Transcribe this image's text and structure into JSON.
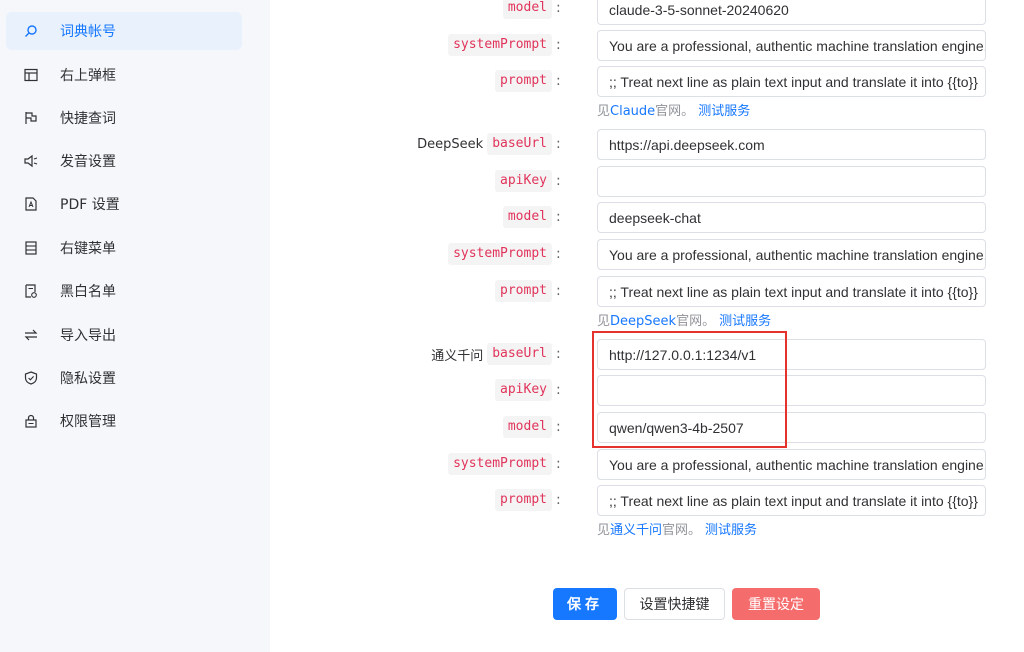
{
  "sidebar": {
    "items": [
      {
        "label": "词典帐号",
        "icon": "search-icon",
        "active": true
      },
      {
        "label": "右上弹框",
        "icon": "panel-icon"
      },
      {
        "label": "快捷查词",
        "icon": "flag-icon"
      },
      {
        "label": "发音设置",
        "icon": "speaker-icon"
      },
      {
        "label": "PDF 设置",
        "icon": "pdf-icon"
      },
      {
        "label": "右键菜单",
        "icon": "menu-list-icon"
      },
      {
        "label": "黑白名单",
        "icon": "list-check-icon"
      },
      {
        "label": "导入导出",
        "icon": "swap-icon"
      },
      {
        "label": "隐私设置",
        "icon": "shield-icon"
      },
      {
        "label": "权限管理",
        "icon": "lock-icon"
      }
    ]
  },
  "claude": {
    "model": {
      "key": "model",
      "value": "claude-3-5-sonnet-20240620"
    },
    "systemPrompt": {
      "key": "systemPrompt",
      "value": "You are a professional, authentic machine translation engine."
    },
    "prompt": {
      "key": "prompt",
      "value": ";; Treat next line as plain text input and translate it into {{to}}"
    },
    "help": {
      "prefix": "见",
      "link": "Claude",
      "suffix": "官网。",
      "test": "测试服务"
    }
  },
  "deepseek": {
    "name": "DeepSeek",
    "baseUrl": {
      "key": "baseUrl",
      "value": "https://api.deepseek.com"
    },
    "apiKey": {
      "key": "apiKey",
      "value": ""
    },
    "model": {
      "key": "model",
      "value": "deepseek-chat"
    },
    "systemPrompt": {
      "key": "systemPrompt",
      "value": "You are a professional, authentic machine translation engine."
    },
    "prompt": {
      "key": "prompt",
      "value": ";; Treat next line as plain text input and translate it into {{to}}"
    },
    "help": {
      "prefix": "见",
      "link": "DeepSeek",
      "suffix": "官网。",
      "test": "测试服务"
    }
  },
  "tongyi": {
    "name": "通义千问",
    "baseUrl": {
      "key": "baseUrl",
      "value": "http://127.0.0.1:1234/v1"
    },
    "apiKey": {
      "key": "apiKey",
      "value": ""
    },
    "model": {
      "key": "model",
      "value": "qwen/qwen3-4b-2507"
    },
    "systemPrompt": {
      "key": "systemPrompt",
      "value": "You are a professional, authentic machine translation engine."
    },
    "prompt": {
      "key": "prompt",
      "value": ";; Treat next line as plain text input and translate it into {{to}}"
    },
    "help": {
      "prefix": "见",
      "link": "通义千问",
      "suffix": "官网。",
      "test": "测试服务"
    }
  },
  "colon": ":",
  "buttons": {
    "save": "保存",
    "shortcut": "设置快捷键",
    "reset": "重置设定"
  },
  "colors": {
    "accent": "#1677ff",
    "tag": "#e1345a",
    "danger": "#f56c6c",
    "highlight": "#e5322d"
  }
}
